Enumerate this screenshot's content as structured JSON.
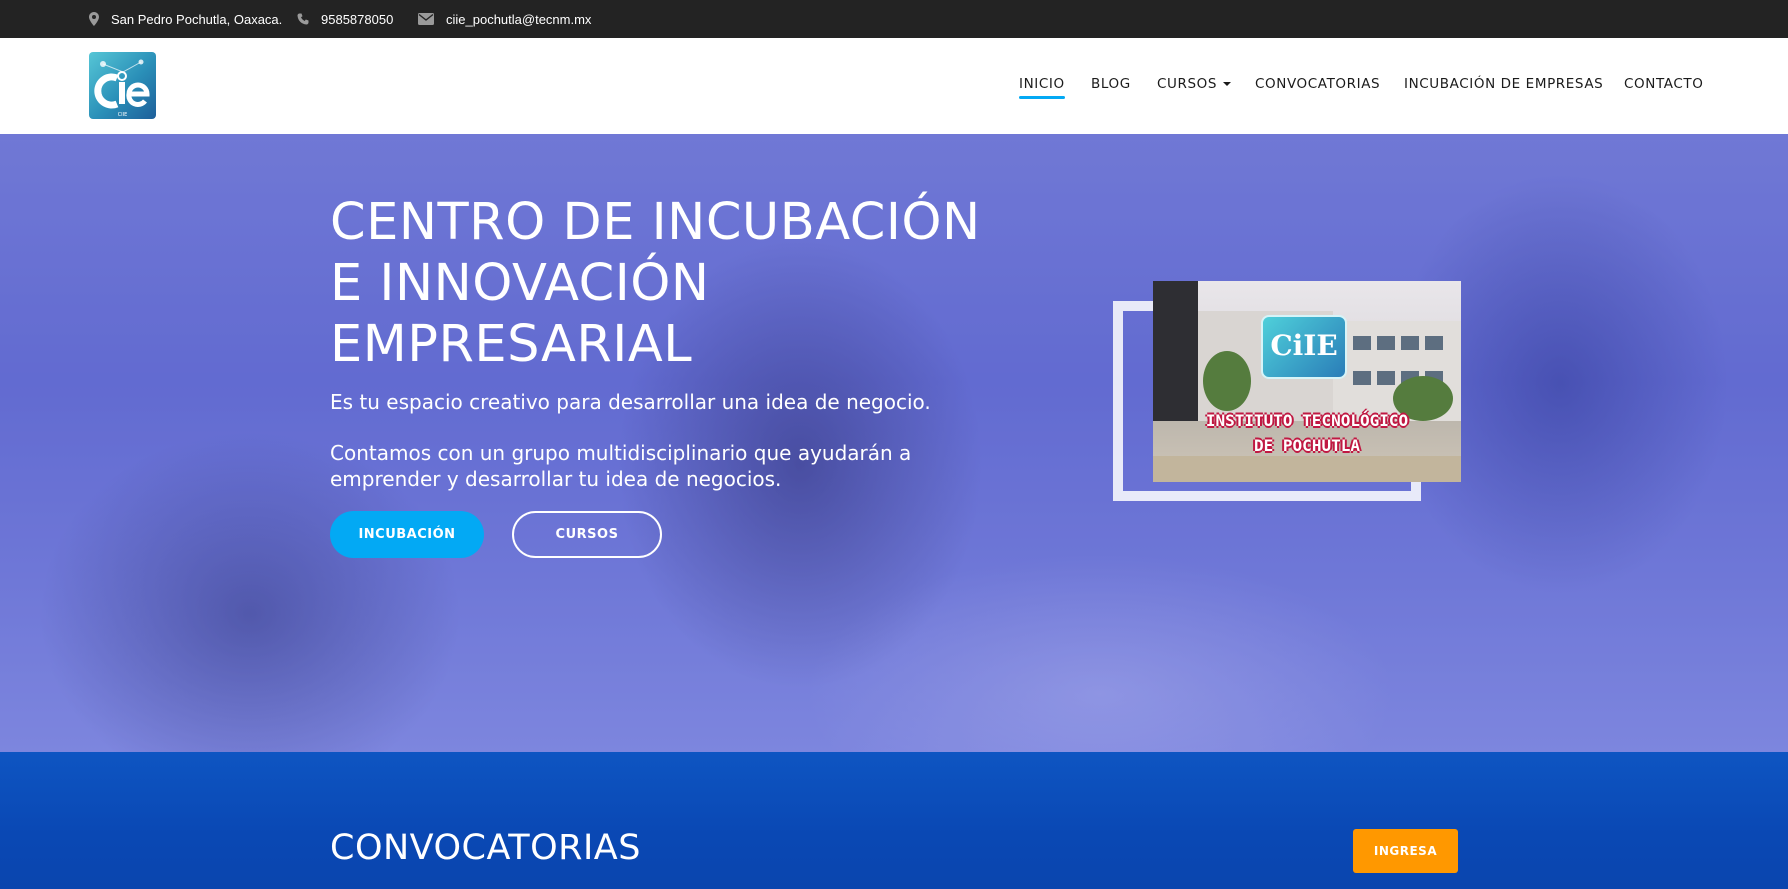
{
  "topbar": {
    "address": "San Pedro Pochutla, Oaxaca.",
    "phone": "9585878050",
    "email": "ciie_pochutla@tecnm.mx",
    "icons": [
      "map-marker-icon",
      "phone-icon",
      "envelope-icon"
    ]
  },
  "header": {
    "logo_text": "CIIE",
    "nav": [
      {
        "label": "INICIO",
        "active": true
      },
      {
        "label": "BLOG"
      },
      {
        "label": "CURSOS",
        "dropdown": true
      },
      {
        "label": "CONVOCATORIAS"
      },
      {
        "label": "INCUBACIÓN DE EMPRESAS"
      },
      {
        "label": "CONTACTO"
      }
    ]
  },
  "hero": {
    "title": "CENTRO DE INCUBACIÓN E INNOVACIÓN EMPRESARIAL",
    "subtitle": "Es tu espacio creativo para desarrollar una idea de negocio.",
    "description": "Contamos con un grupo multidisciplinario que ayudarán a emprender y desarrollar tu idea de negocios.",
    "primary_button": "INCUBACIÓN",
    "secondary_button": "CURSOS",
    "image": {
      "badge_text": "CiIE",
      "caption_line1": "INSTITUTO TECNOLÓGICO",
      "caption_line2": "DE POCHUTLA"
    }
  },
  "convocatorias": {
    "heading": "CONVOCATORIAS",
    "button": "INGRESA"
  },
  "colors": {
    "accent": "#03a9f4",
    "topbar": "#232323",
    "section": "#0a48b4",
    "cta": "#ff9800"
  }
}
